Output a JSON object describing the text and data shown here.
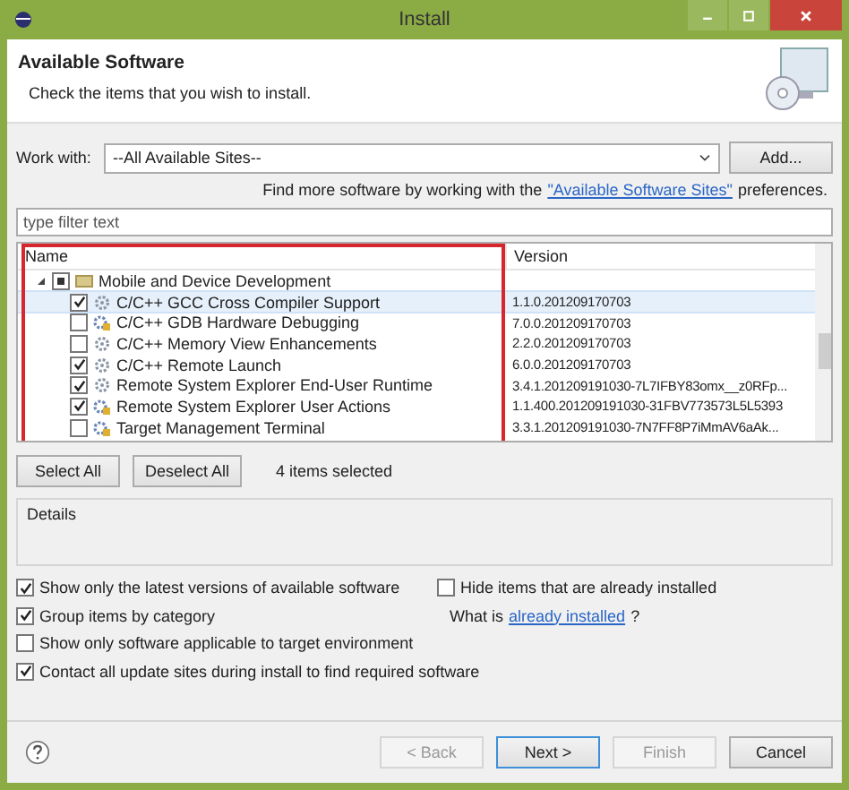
{
  "window": {
    "title": "Install"
  },
  "header": {
    "title": "Available Software",
    "subtitle": "Check the items that you wish to install."
  },
  "work_with": {
    "label": "Work with:",
    "value": "--All Available Sites--",
    "add_button": "Add..."
  },
  "find_more": {
    "before": "Find more software by working with the",
    "link": "\"Available Software Sites\"",
    "after": "preferences."
  },
  "filter": {
    "placeholder": "type filter text"
  },
  "tree": {
    "columns": [
      "Name",
      "Version"
    ],
    "items": [
      {
        "name": "Mobile and Device Development",
        "kind": "category",
        "expanded": true,
        "checked": true,
        "partial": true,
        "selected": false,
        "children": [
          {
            "name": "C/C++ GCC Cross Compiler Support",
            "version": "1.1.0.201209170703",
            "kind": "feature",
            "checked": true,
            "selected": true
          },
          {
            "name": "C/C++ GDB Hardware Debugging",
            "version": "7.0.0.201209170703",
            "kind": "plugin",
            "checked": false,
            "selected": false
          },
          {
            "name": "C/C++ Memory View Enhancements",
            "version": "2.2.0.201209170703",
            "kind": "feature",
            "checked": false,
            "selected": false
          },
          {
            "name": "C/C++ Remote Launch",
            "version": "6.0.0.201209170703",
            "kind": "feature",
            "checked": true,
            "selected": false
          },
          {
            "name": "Remote System Explorer End-User Runtime",
            "version": "3.4.1.201209191030-7L7IFBY83omx__z0RFp...",
            "kind": "feature",
            "checked": true,
            "selected": false
          },
          {
            "name": "Remote System Explorer User Actions",
            "version": "1.1.400.201209191030-31FBV773573L5L5393",
            "kind": "plugin",
            "checked": true,
            "selected": false
          },
          {
            "name": "Target Management Terminal",
            "version": "3.3.1.201209191030-7N7FF8P7iMmAV6aAk...",
            "kind": "plugin",
            "checked": false,
            "selected": false
          }
        ]
      }
    ]
  },
  "selection": {
    "select_all": "Select All",
    "deselect_all": "Deselect All",
    "count": "4 items selected"
  },
  "details": {
    "label": "Details"
  },
  "options_left": [
    {
      "label": "Show only the latest versions of available software",
      "checked": true
    },
    {
      "label": "Group items by category",
      "checked": true
    },
    {
      "label": "Show only software applicable to target environment",
      "checked": false
    },
    {
      "label": "Contact all update sites during install to find required software",
      "checked": true
    }
  ],
  "options_right": {
    "hide_installed": {
      "label": "Hide items that are already installed",
      "checked": false
    },
    "what_is": "What is",
    "link": "already installed",
    "after": "?"
  },
  "footer": {
    "buttons": [
      {
        "label": "< Back",
        "disabled": true,
        "default": false
      },
      {
        "label": "Next >",
        "disabled": false,
        "default": true
      },
      {
        "label": "Finish",
        "disabled": true,
        "default": false
      },
      {
        "label": "Cancel",
        "disabled": false,
        "default": false
      }
    ]
  }
}
